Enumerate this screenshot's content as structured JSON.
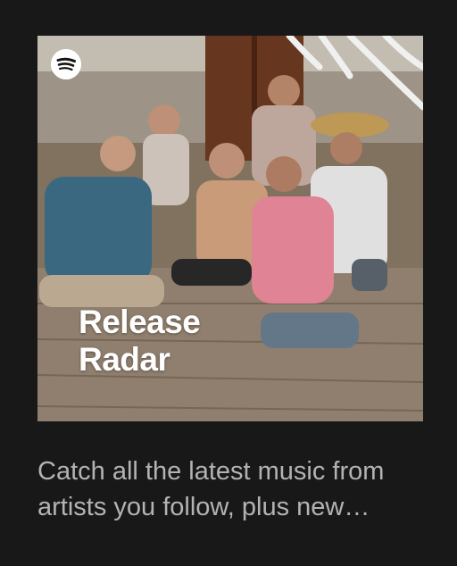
{
  "card": {
    "cover": {
      "brand_icon": "spotify-logo-icon",
      "title_line1": "Release",
      "title_line2": "Radar"
    },
    "description": "Catch all the latest music from artists you follow, plus new singles picked for you. Updates every Friday."
  },
  "colors": {
    "background": "#121212",
    "card": "#181818",
    "description_text": "#b3b3b3",
    "title_text": "#ffffff"
  }
}
